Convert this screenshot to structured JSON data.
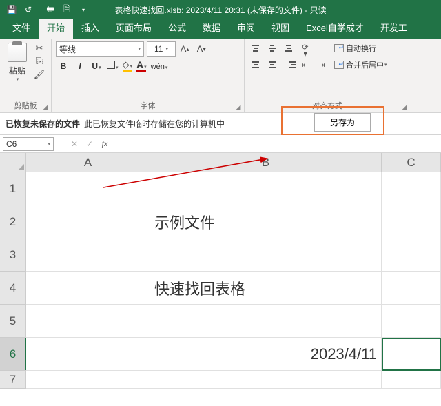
{
  "title": "表格快速找回.xlsb: 2023/4/11 20:31 (未保存的文件)  -  只读",
  "tabs": [
    "文件",
    "开始",
    "插入",
    "页面布局",
    "公式",
    "数据",
    "审阅",
    "视图",
    "Excel自学成才",
    "开发工"
  ],
  "active_tab": 1,
  "ribbon": {
    "clipboard": {
      "paste": "粘贴",
      "label": "剪贴板"
    },
    "font": {
      "name": "等线",
      "size": "11",
      "bold": "B",
      "italic": "I",
      "underline": "U",
      "wen": "wén",
      "label": "字体"
    },
    "align": {
      "wrap": "自动换行",
      "merge": "合并后居中",
      "label": "对齐方式"
    }
  },
  "recovery": {
    "msg": "已恢复未保存的文件",
    "link": "此已恢复文件临时存储在您的计算机中",
    "saveas": "另存为"
  },
  "name_box": "C6",
  "columns": [
    "A",
    "B",
    "C"
  ],
  "rows": [
    "1",
    "2",
    "3",
    "4",
    "5",
    "6",
    "7"
  ],
  "cells": {
    "B2": "示例文件",
    "B4": "快速找回表格",
    "B6": "2023/4/11"
  },
  "chart_data": {
    "type": "table",
    "columns": [
      "A",
      "B",
      "C"
    ],
    "data": [
      {
        "row": 1,
        "A": "",
        "B": "",
        "C": ""
      },
      {
        "row": 2,
        "A": "",
        "B": "示例文件",
        "C": ""
      },
      {
        "row": 3,
        "A": "",
        "B": "",
        "C": ""
      },
      {
        "row": 4,
        "A": "",
        "B": "快速找回表格",
        "C": ""
      },
      {
        "row": 5,
        "A": "",
        "B": "",
        "C": ""
      },
      {
        "row": 6,
        "A": "",
        "B": "2023/4/11",
        "C": ""
      },
      {
        "row": 7,
        "A": "",
        "B": "",
        "C": ""
      }
    ],
    "selected_cell": "C6"
  }
}
